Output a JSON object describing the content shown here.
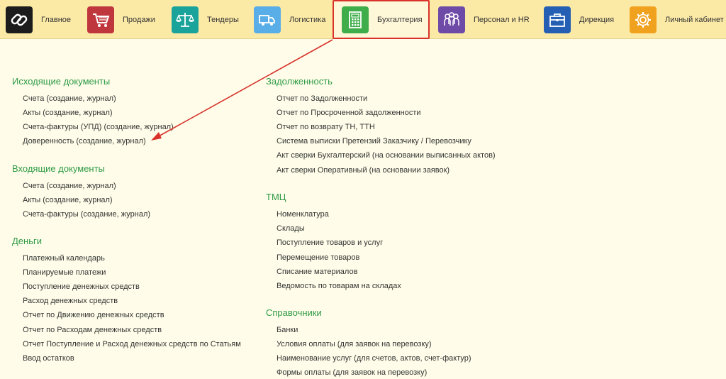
{
  "nav": [
    {
      "label": "Главное",
      "icon": "link-icon",
      "color": "#1c1c1c"
    },
    {
      "label": "Продажи",
      "icon": "shopping-cart-icon",
      "color": "#c0363d"
    },
    {
      "label": "Тендеры",
      "icon": "scales-icon",
      "color": "#1aa39a"
    },
    {
      "label": "Логистика",
      "icon": "truck-icon",
      "color": "#5aaee8"
    },
    {
      "label": "Бухгалтерия",
      "icon": "calculator-icon",
      "color": "#3fad49"
    },
    {
      "label": "Персонал и HR",
      "icon": "people-icon",
      "color": "#6f4ba8"
    },
    {
      "label": "Дирекция",
      "icon": "briefcase-icon",
      "color": "#245fb4"
    },
    {
      "label": "Личный кабинет",
      "icon": "gear-icon",
      "color": "#f0a21e"
    }
  ],
  "active_nav": "Бухгалтерия",
  "accent_color": "#2d9a46",
  "highlight_color": "#d9322b",
  "left_sections": [
    {
      "title": "Исходящие документы",
      "items": [
        "Счета (создание, журнал)",
        "Акты (создание, журнал)",
        "Счета-фактуры (УПД) (создание, журнал)",
        "Доверенность (создание, журнал)"
      ]
    },
    {
      "title": "Входящие документы",
      "items": [
        "Счета (создание, журнал)",
        "Акты (создание, журнал)",
        "Счета-фактуры (создание, журнал)"
      ]
    },
    {
      "title": "Деньги",
      "items": [
        "Платежный календарь",
        "Планируемые платежи",
        "Поступление денежных средств",
        "Расход денежных средств",
        "Отчет по Движению денежных средств",
        "Отчет по Расходам денежных средств",
        "Отчет Поступление и Расход денежных средств по Статьям",
        "Ввод остатков"
      ]
    }
  ],
  "right_sections": [
    {
      "title": "Задолженность",
      "items": [
        "Отчет по Задолженности",
        "Отчет по Просроченной задолженности",
        "Отчет по возврату ТН, ТТН",
        "Система выписки Претензий Заказчику / Перевозчику",
        "Акт сверки Бухгалтерский (на основании выписанных актов)",
        "Акт сверки Оперативный (на основании заявок)"
      ]
    },
    {
      "title": "ТМЦ",
      "items": [
        "Номенклатура",
        "Склады",
        "Поступление товаров и услуг",
        "Перемещение товаров",
        "Списание материалов",
        "Ведомость по товарам на складах"
      ]
    },
    {
      "title": "Справочники",
      "items": [
        "Банки",
        "Условия оплаты (для заявок на перевозку)",
        "Наименование услуг (для счетов, актов, счет-фактур)",
        "Формы оплаты (для заявок на перевозку)"
      ]
    }
  ]
}
